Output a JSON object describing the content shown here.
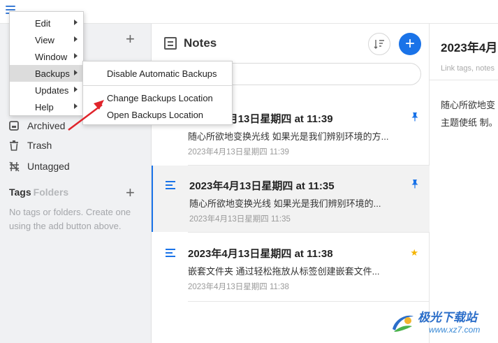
{
  "sidebar": {
    "items": [
      {
        "label": "Archived"
      },
      {
        "label": "Trash"
      },
      {
        "label": "Untagged"
      }
    ],
    "tags_title": "Tags",
    "tags_sub": "Folders",
    "tags_empty": "No tags or folders. Create one using the add button above."
  },
  "notes": {
    "title": "Notes",
    "items": [
      {
        "title": "2023年4月13日星期四 at 11:39",
        "preview": "随心所欲地变换光线 如果光是我们辨别环境的方...",
        "date": "2023年4月13日星期四 11:39",
        "mark": "pin"
      },
      {
        "title": "2023年4月13日星期四 at 11:35",
        "preview": "随心所欲地变换光线 如果光是我们辨别环境的...",
        "date": "2023年4月13日星期四 11:35",
        "mark": "pin"
      },
      {
        "title": "2023年4月13日星期四 at 11:38",
        "preview": "嵌套文件夹 通过轻松拖放从标签创建嵌套文件...",
        "date": "2023年4月13日星期四 11:38",
        "mark": "star"
      }
    ]
  },
  "editor": {
    "title": "2023年4月",
    "tags_placeholder": "Link tags, notes",
    "body": "随心所欲地变 如果光是我们 态。主题使纸 制。第三方的"
  },
  "main_menu": {
    "items": [
      {
        "label": "Edit"
      },
      {
        "label": "View"
      },
      {
        "label": "Window"
      },
      {
        "label": "Backups"
      },
      {
        "label": "Updates"
      },
      {
        "label": "Help"
      }
    ]
  },
  "backups_menu": {
    "items": [
      {
        "label": "Disable Automatic Backups"
      },
      {
        "label": "Change Backups Location"
      },
      {
        "label": "Open Backups Location"
      }
    ]
  },
  "watermark": {
    "line1": "极光下载站",
    "line2": "www.xz7.com"
  },
  "colors": {
    "accent": "#1a73e8",
    "star": "#f5b400",
    "annotation_arrow": "#e0242b"
  }
}
